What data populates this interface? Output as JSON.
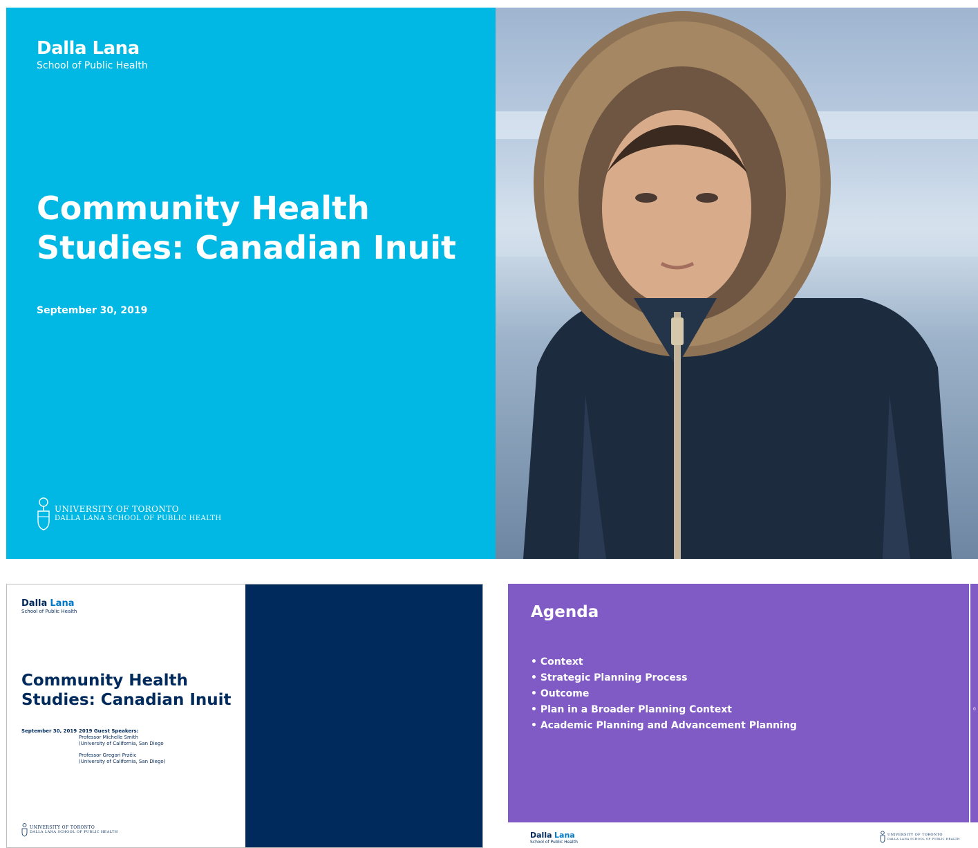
{
  "slide1": {
    "logo_word": "Dalla Lana",
    "logo_sub": "School of Public Health",
    "title": "Community Health Studies: Canadian Inuit",
    "date": "September 30, 2019",
    "uoft_line1": "UNIVERSITY OF TORONTO",
    "uoft_line2": "DALLA LANA SCHOOL OF PUBLIC HEALTH",
    "colors": {
      "background": "#00b8e3",
      "text": "#ffffff"
    }
  },
  "slide2": {
    "logo_word_1": "Dalla",
    "logo_word_2": "Lana",
    "logo_sub": "School of Public Health",
    "title": "Community Health Studies: Canadian Inuit",
    "date": "September 30, 2019",
    "speakers_label": "2019 Guest Speakers:",
    "speakers": [
      {
        "name": "Professor Michelle Smith",
        "affiliation": "(University of California, San Diego"
      },
      {
        "name": "Professor Gregori Przëic",
        "affiliation": "(University of California, San Diego)"
      }
    ],
    "uoft_line1": "UNIVERSITY OF TORONTO",
    "uoft_line2": "DALLA LANA SCHOOL OF PUBLIC HEALTH",
    "colors": {
      "navy": "#002a5c"
    }
  },
  "slide3": {
    "heading": "Agenda",
    "items": [
      "• Context",
      "• Strategic Planning Process",
      "• Outcome",
      "• Plan in a Broader Planning Context",
      "• Academic Planning and Advancement Planning"
    ],
    "page_number": "0",
    "footer_logo_word_1": "Dalla",
    "footer_logo_word_2": "Lana",
    "footer_logo_sub": "School of Public Health",
    "uoft_line1": "UNIVERSITY OF TORONTO",
    "uoft_line2": "DALLA LANA SCHOOL OF PUBLIC HEALTH",
    "colors": {
      "background": "#805bc6"
    }
  }
}
